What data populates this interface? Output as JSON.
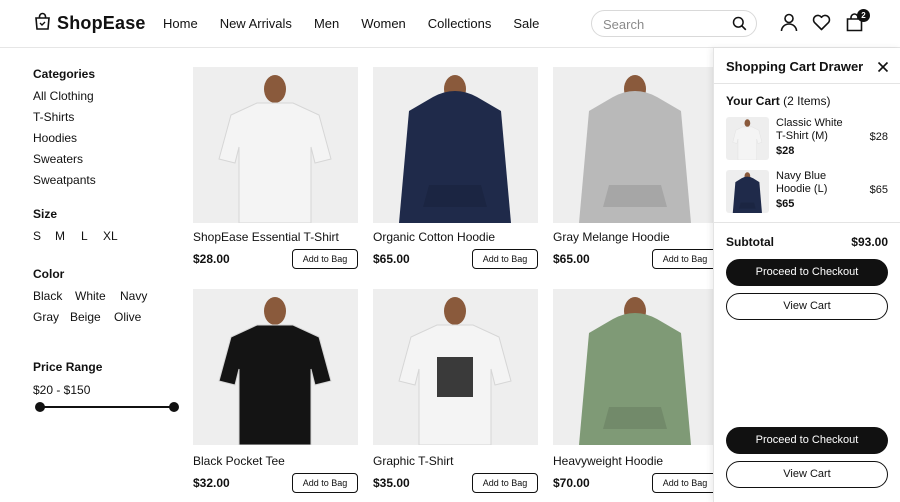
{
  "header": {
    "brand": "ShopEase",
    "nav": [
      "Home",
      "New Arrivals",
      "Men",
      "Women",
      "Collections",
      "Sale"
    ],
    "search_placeholder": "Search",
    "cart_count": "2"
  },
  "sidebar": {
    "categories_heading": "Categories",
    "categories": [
      "All Clothing",
      "T-Shirts",
      "Hoodies",
      "Sweaters",
      "Sweatpants"
    ],
    "size_heading": "Size",
    "sizes": [
      "S",
      "M",
      "L",
      "XL"
    ],
    "color_heading": "Color",
    "colors": [
      "Black",
      "White",
      "Navy",
      "Gray",
      "Beige",
      "Olive"
    ],
    "price_heading": "Price Range",
    "price_range": "$20 - $150"
  },
  "products": [
    {
      "name": "ShopEase Essential T-Shirt",
      "price": "$28.00",
      "button": "Add to Bag",
      "color": "#f4f4f4",
      "kind": "tee"
    },
    {
      "name": "Organic Cotton Hoodie",
      "price": "$65.00",
      "button": "Add to Bag",
      "color": "#1f2a4a",
      "kind": "hoodie"
    },
    {
      "name": "Gray Melange Hoodie",
      "price": "$65.00",
      "button": "Add to Bag",
      "color": "#b9b9b9",
      "kind": "hoodie"
    },
    {
      "name": "Black Pocket Tee",
      "price": "$32.00",
      "button": "Add to Bag",
      "color": "#141414",
      "kind": "tee"
    },
    {
      "name": "Graphic T-Shirt",
      "price": "$35.00",
      "button": "Add to Bag",
      "color": "#f4f4f4",
      "kind": "graphic"
    },
    {
      "name": "Heavyweight Hoodie",
      "price": "$70.00",
      "button": "Add to Bag",
      "color": "#7f9a76",
      "kind": "hoodie"
    }
  ],
  "drawer": {
    "title": "Shopping Cart Drawer",
    "your_cart": "Your Cart",
    "items_count": "(2 Items)",
    "items": [
      {
        "name": "Classic White T-Shirt (M)",
        "price": "$28",
        "total": "$28",
        "color": "#f4f4f4"
      },
      {
        "name": "Navy Blue Hoodie (L)",
        "price": "$65",
        "total": "$65",
        "color": "#1f2a4a"
      }
    ],
    "subtotal_label": "Subtotal",
    "subtotal_value": "$93.00",
    "checkout_label": "Proceed to Checkout",
    "view_cart_label": "View Cart"
  }
}
